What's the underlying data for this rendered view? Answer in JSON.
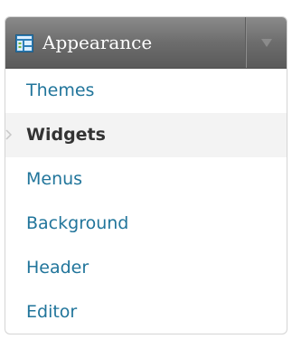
{
  "menu": {
    "title": "Appearance",
    "icon": "appearance-icon",
    "toggle_icon": "chevron-down-icon",
    "items": [
      {
        "label": "Themes",
        "current": false
      },
      {
        "label": "Widgets",
        "current": true
      },
      {
        "label": "Menus",
        "current": false
      },
      {
        "label": "Background",
        "current": false
      },
      {
        "label": "Header",
        "current": false
      },
      {
        "label": "Editor",
        "current": false
      }
    ]
  },
  "colors": {
    "header_background": "#6d6d6d",
    "link": "#21759b",
    "current_text": "#333333",
    "current_background": "#f3f3f3",
    "icon_accent": "#2e7fb8"
  }
}
